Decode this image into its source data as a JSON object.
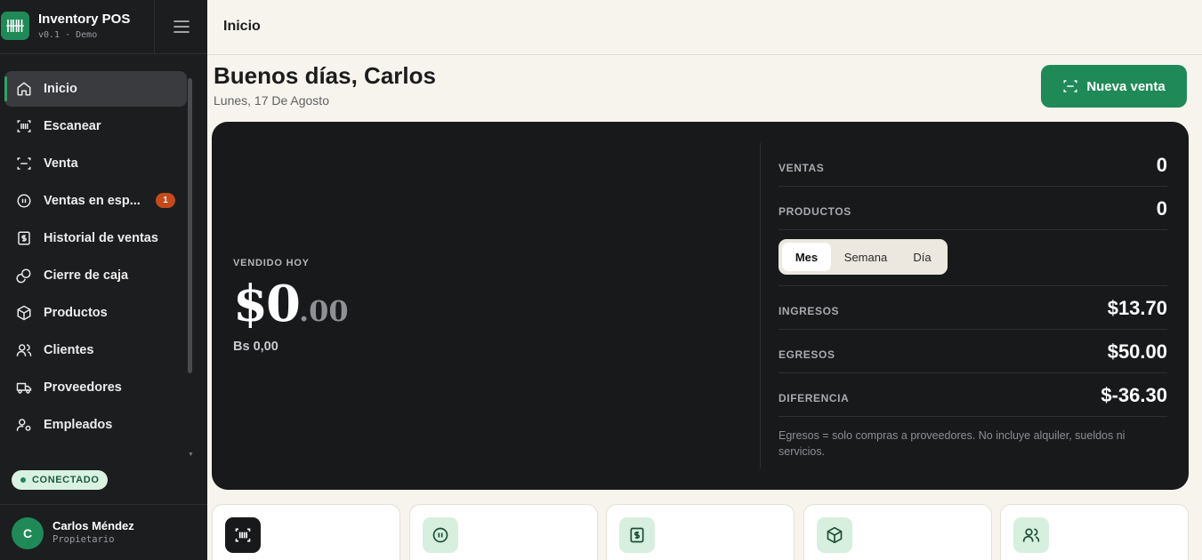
{
  "app": {
    "title": "Inventory POS",
    "version": "v0.1 · Demo"
  },
  "sidebar": {
    "items": [
      {
        "label": "Inicio",
        "icon": "home-icon",
        "active": true
      },
      {
        "label": "Escanear",
        "icon": "barcode-scan-icon"
      },
      {
        "label": "Venta",
        "icon": "scan-frame-icon"
      },
      {
        "label": "Ventas en esp...",
        "icon": "pause-circle-icon",
        "badge": "1"
      },
      {
        "label": "Historial de ventas",
        "icon": "receipt-dollar-icon"
      },
      {
        "label": "Cierre de caja",
        "icon": "coins-icon"
      },
      {
        "label": "Productos",
        "icon": "box-icon"
      },
      {
        "label": "Clientes",
        "icon": "users-icon"
      },
      {
        "label": "Proveedores",
        "icon": "truck-icon"
      },
      {
        "label": "Empleados",
        "icon": "user-gear-icon"
      }
    ],
    "status": "CONECTADO",
    "user": {
      "initial": "C",
      "name": "Carlos Méndez",
      "role": "Propietario"
    }
  },
  "topbar": {
    "title": "Inicio"
  },
  "main": {
    "greeting": "Buenos días, Carlos",
    "date": "Lunes, 17 De Agosto",
    "new_sale_label": "Nueva venta",
    "hero": {
      "sold_label": "VENDIDO HOY",
      "sold_int": "$0",
      "sold_dec": ".00",
      "sold_bs": "Bs 0,00",
      "ventas_label": "VENTAS",
      "ventas_value": "0",
      "productos_label": "PRODUCTOS",
      "productos_value": "0",
      "periods": [
        "Mes",
        "Semana",
        "Día"
      ],
      "active_period": "Mes",
      "ingresos_label": "INGRESOS",
      "ingresos_value": "$13.70",
      "egresos_label": "EGRESOS",
      "egresos_value": "$50.00",
      "diferencia_label": "DIFERENCIA",
      "diferencia_value": "$-36.30",
      "note": "Egresos = solo compras a proveedores. No incluye alquiler, sueldos ni servicios."
    },
    "cards": [
      {
        "icon": "barcode-scan-icon"
      },
      {
        "icon": "pause-circle-icon"
      },
      {
        "icon": "receipt-dollar-icon"
      },
      {
        "icon": "box-icon"
      },
      {
        "icon": "users-icon"
      }
    ]
  },
  "colors": {
    "accent": "#1f8a58",
    "sidebar_bg": "#1c1d1f",
    "hero_bg": "#18191b",
    "badge": "#c44a1b",
    "page_bg": "#f7f4ee"
  }
}
